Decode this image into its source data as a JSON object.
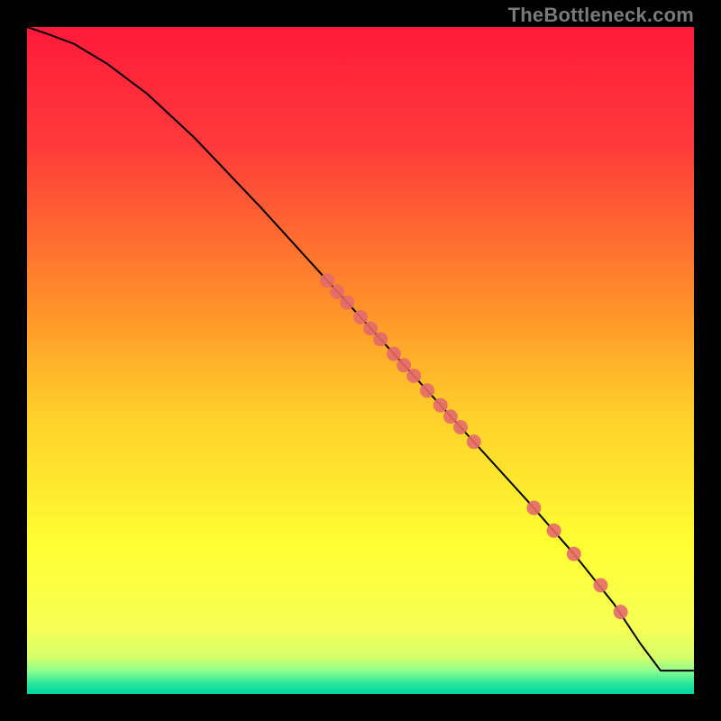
{
  "watermark": "TheBottleneck.com",
  "chart_data": {
    "type": "line",
    "title": "",
    "xlabel": "",
    "ylabel": "",
    "xlim": [
      0,
      100
    ],
    "ylim": [
      0,
      100
    ],
    "gradient_stops": [
      {
        "offset": 0.0,
        "color": "#ff1a3a"
      },
      {
        "offset": 0.18,
        "color": "#ff3b3b"
      },
      {
        "offset": 0.4,
        "color": "#ff8a2a"
      },
      {
        "offset": 0.58,
        "color": "#ffcf2a"
      },
      {
        "offset": 0.78,
        "color": "#ffff33"
      },
      {
        "offset": 0.9,
        "color": "#f7ff55"
      },
      {
        "offset": 0.945,
        "color": "#d6ff6a"
      },
      {
        "offset": 0.965,
        "color": "#8fff8f"
      },
      {
        "offset": 0.985,
        "color": "#25e59b"
      },
      {
        "offset": 1.0,
        "color": "#00d6a2"
      }
    ],
    "series": [
      {
        "name": "curve",
        "stroke": "#000000",
        "stroke_width": 2,
        "x": [
          0,
          3,
          7,
          12,
          18,
          25,
          35,
          45,
          55,
          65,
          75,
          82,
          88,
          92,
          95,
          100
        ],
        "y": [
          100,
          99,
          97.5,
          94.5,
          90,
          83.5,
          73,
          62,
          51,
          40,
          29,
          21,
          13.5,
          7.5,
          3.5,
          3.5
        ]
      }
    ],
    "points": {
      "name": "markers",
      "fill": "#e46a6a",
      "radius": 8,
      "xy": [
        [
          45,
          62
        ],
        [
          46.5,
          60.3
        ],
        [
          48,
          58.7
        ],
        [
          50,
          56.5
        ],
        [
          51.5,
          54.8
        ],
        [
          53,
          53.2
        ],
        [
          55,
          51
        ],
        [
          56.5,
          49.3
        ],
        [
          58,
          47.7
        ],
        [
          60,
          45.5
        ],
        [
          62,
          43.3
        ],
        [
          63.5,
          41.6
        ],
        [
          65,
          40
        ],
        [
          67,
          37.8
        ],
        [
          76,
          27.9
        ],
        [
          79,
          24.5
        ],
        [
          82,
          21
        ],
        [
          86,
          16.3
        ],
        [
          89,
          12.3
        ]
      ]
    }
  }
}
